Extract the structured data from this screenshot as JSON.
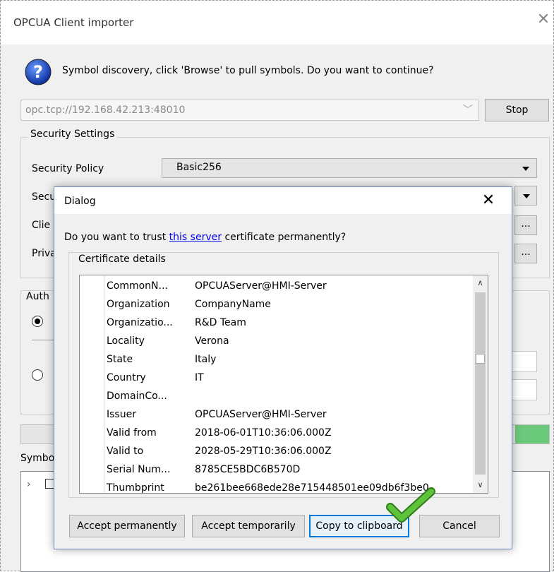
{
  "window": {
    "title": "OPCUA Client importer",
    "prompt": "Symbol discovery, click 'Browse' to pull symbols. Do you want to continue?",
    "url": "opc.tcp://192.168.42.213:48010",
    "stop_label": "Stop",
    "security_legend": "Security Settings",
    "security_policy_label": "Security Policy",
    "security_policy_value": "Basic256",
    "secu_label_partial": "Secu",
    "clie_label_partial": "Clie",
    "priv_label_partial": "Priva",
    "dots_label": "...",
    "auth_label_partial": "Auth",
    "symbols_label_partial": "Symbo"
  },
  "dialog": {
    "title": "Dialog",
    "question_prefix": "Do you want to trust ",
    "question_link": "this server",
    "question_suffix": " certificate permanently?",
    "cert_legend": "Certificate details",
    "rows": [
      {
        "key": "CommonN...",
        "value": "OPCUAServer@HMI-Server"
      },
      {
        "key": "Organization",
        "value": "CompanyName"
      },
      {
        "key": "Organizatio...",
        "value": "R&D Team"
      },
      {
        "key": "Locality",
        "value": "Verona"
      },
      {
        "key": "State",
        "value": "Italy"
      },
      {
        "key": "Country",
        "value": "IT"
      },
      {
        "key": "DomainCo...",
        "value": ""
      },
      {
        "key": "Issuer",
        "value": "OPCUAServer@HMI-Server"
      },
      {
        "key": "Valid from",
        "value": "2018-06-01T10:36:06.000Z"
      },
      {
        "key": "Valid to",
        "value": "2028-05-29T10:36:06.000Z"
      },
      {
        "key": "Serial Num...",
        "value": "8785CE5BDC6B570D"
      },
      {
        "key": "Thumbprint",
        "value": "be261bee668ede28e715448501ee09db6f3be0"
      }
    ],
    "buttons": {
      "accept_permanently": "Accept permanently",
      "accept_temporarily": "Accept temporarily",
      "copy_to_clipboard": "Copy to clipboard",
      "cancel": "Cancel"
    }
  },
  "icons": {
    "question": "question-icon",
    "close": "close-icon",
    "dropdown": "dropdown-arrow-icon",
    "checkmark": "checkmark-icon"
  },
  "colors": {
    "link": "#0000ee",
    "accent": "#0078d7",
    "progress": "#06b025",
    "check": "#5ec33a"
  }
}
